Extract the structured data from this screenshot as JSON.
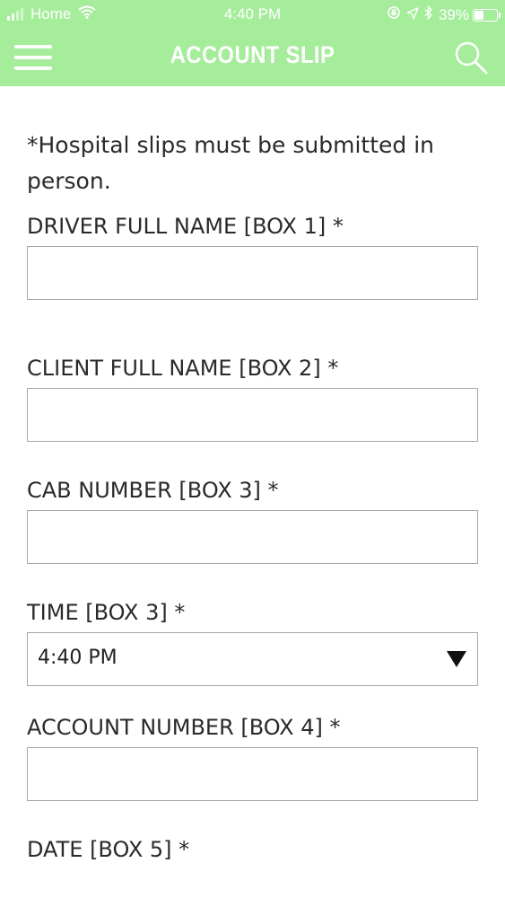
{
  "status_bar": {
    "carrier": "Home",
    "time": "4:40 PM",
    "battery_percent": "39%",
    "battery_level": 0.39,
    "icons": [
      "signal-bars-icon",
      "wifi-icon",
      "screen-lock-icon",
      "location-arrow-icon",
      "bluetooth-icon",
      "battery-icon"
    ]
  },
  "header": {
    "title": "ACCOUNT SLIP",
    "background_color": "#a5ec9b",
    "icons": [
      "hamburger-menu-icon",
      "search-icon"
    ]
  },
  "form": {
    "notice": "*Hospital slips must be submitted in person.",
    "fields": [
      {
        "label": "DRIVER FULL NAME [BOX 1] *",
        "value": "",
        "type": "text"
      },
      {
        "label": "CLIENT FULL NAME [BOX 2] *",
        "value": "",
        "type": "text"
      },
      {
        "label": "CAB NUMBER [BOX 3] *",
        "value": "",
        "type": "text"
      },
      {
        "label": "TIME [BOX 3] *",
        "value": "4:40 PM",
        "type": "select"
      },
      {
        "label": "ACCOUNT NUMBER [BOX 4] *",
        "value": "",
        "type": "text"
      },
      {
        "label": "DATE [BOX 5] *",
        "value": "",
        "type": "date"
      }
    ]
  }
}
